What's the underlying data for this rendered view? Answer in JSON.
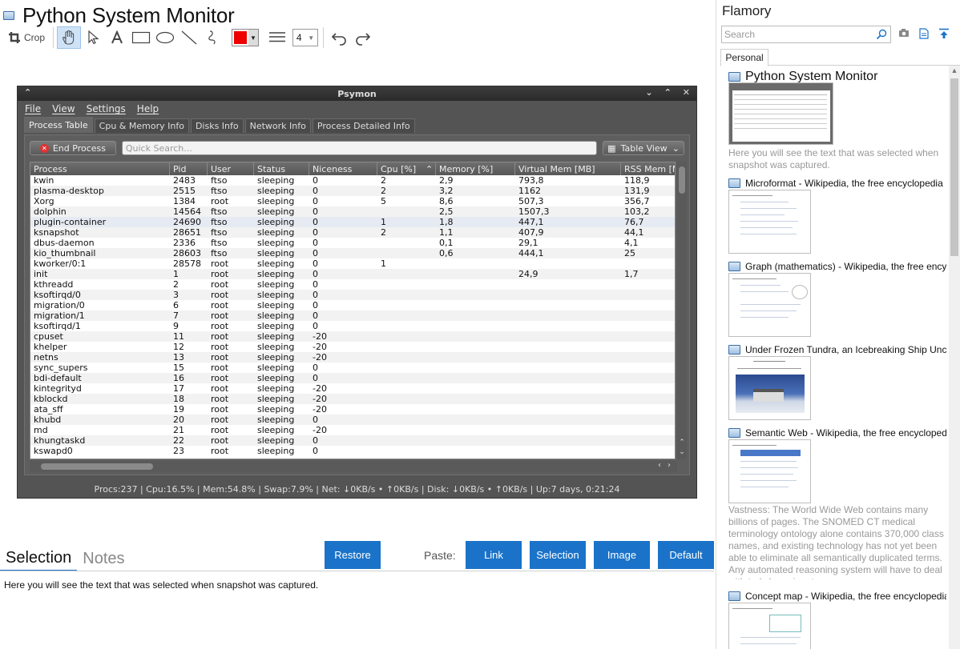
{
  "app": {
    "title": "Python System Monitor",
    "toolbar": {
      "crop_label": "Crop",
      "line_width": "4"
    }
  },
  "psymon": {
    "title": "Psymon",
    "menu": [
      "File",
      "View",
      "Settings",
      "Help"
    ],
    "tabs": [
      "Process Table",
      "Cpu & Memory Info",
      "Disks Info",
      "Network Info",
      "Process Detailed Info"
    ],
    "end_process_label": "End Process",
    "search_placeholder": "Quick Search...",
    "view_label": "Table View",
    "columns": [
      "Process",
      "Pid",
      "User",
      "Status",
      "Niceness",
      "Cpu [%]",
      "Memory [%]",
      "Virtual Mem [MB]",
      "RSS Mem [M"
    ],
    "rows": [
      [
        "kwin",
        "2483",
        "ftso",
        "sleeping",
        "0",
        "2",
        "2,9",
        "793,8",
        "118,9"
      ],
      [
        "plasma-desktop",
        "2515",
        "ftso",
        "sleeping",
        "0",
        "2",
        "3,2",
        "1162",
        "131,9"
      ],
      [
        "Xorg",
        "1384",
        "root",
        "sleeping",
        "0",
        "5",
        "8,6",
        "507,3",
        "356,7"
      ],
      [
        "dolphin",
        "14564",
        "ftso",
        "sleeping",
        "0",
        "",
        "2,5",
        "1507,3",
        "103,2"
      ],
      [
        "plugin-container",
        "24690",
        "ftso",
        "sleeping",
        "0",
        "1",
        "1,8",
        "447,1",
        "76,7"
      ],
      [
        "ksnapshot",
        "28651",
        "ftso",
        "sleeping",
        "0",
        "2",
        "1,1",
        "407,9",
        "44,1"
      ],
      [
        "dbus-daemon",
        "2336",
        "ftso",
        "sleeping",
        "0",
        "",
        "0,1",
        "29,1",
        "4,1"
      ],
      [
        "kio_thumbnail",
        "28603",
        "ftso",
        "sleeping",
        "0",
        "",
        "0,6",
        "444,1",
        "25"
      ],
      [
        "kworker/0:1",
        "28578",
        "root",
        "sleeping",
        "0",
        "1",
        "",
        "",
        ""
      ],
      [
        "init",
        "1",
        "root",
        "sleeping",
        "0",
        "",
        "",
        "24,9",
        "1,7"
      ],
      [
        "kthreadd",
        "2",
        "root",
        "sleeping",
        "0",
        "",
        "",
        "",
        ""
      ],
      [
        "ksoftirqd/0",
        "3",
        "root",
        "sleeping",
        "0",
        "",
        "",
        "",
        ""
      ],
      [
        "migration/0",
        "6",
        "root",
        "sleeping",
        "0",
        "",
        "",
        "",
        ""
      ],
      [
        "migration/1",
        "7",
        "root",
        "sleeping",
        "0",
        "",
        "",
        "",
        ""
      ],
      [
        "ksoftirqd/1",
        "9",
        "root",
        "sleeping",
        "0",
        "",
        "",
        "",
        ""
      ],
      [
        "cpuset",
        "11",
        "root",
        "sleeping",
        "-20",
        "",
        "",
        "",
        ""
      ],
      [
        "khelper",
        "12",
        "root",
        "sleeping",
        "-20",
        "",
        "",
        "",
        ""
      ],
      [
        "netns",
        "13",
        "root",
        "sleeping",
        "-20",
        "",
        "",
        "",
        ""
      ],
      [
        "sync_supers",
        "15",
        "root",
        "sleeping",
        "0",
        "",
        "",
        "",
        ""
      ],
      [
        "bdi-default",
        "16",
        "root",
        "sleeping",
        "0",
        "",
        "",
        "",
        ""
      ],
      [
        "kintegrityd",
        "17",
        "root",
        "sleeping",
        "-20",
        "",
        "",
        "",
        ""
      ],
      [
        "kblockd",
        "18",
        "root",
        "sleeping",
        "-20",
        "",
        "",
        "",
        ""
      ],
      [
        "ata_sff",
        "19",
        "root",
        "sleeping",
        "-20",
        "",
        "",
        "",
        ""
      ],
      [
        "khubd",
        "20",
        "root",
        "sleeping",
        "0",
        "",
        "",
        "",
        ""
      ],
      [
        "md",
        "21",
        "root",
        "sleeping",
        "-20",
        "",
        "",
        "",
        ""
      ],
      [
        "khungtaskd",
        "22",
        "root",
        "sleeping",
        "0",
        "",
        "",
        "",
        ""
      ],
      [
        "kswapd0",
        "23",
        "root",
        "sleeping",
        "0",
        "",
        "",
        "",
        ""
      ]
    ],
    "status": "Procs:237 | Cpu:16.5% | Mem:54.8% | Swap:7.9% | Net: ↓0KB/s • ↑0KB/s | Disk: ↓0KB/s • ↑0KB/s | Up:7 days, 0:21:24"
  },
  "bottom": {
    "tabs": [
      "Selection",
      "Notes"
    ],
    "restore_label": "Restore",
    "paste_label": "Paste:",
    "paste_buttons": [
      "Link",
      "Selection",
      "Image",
      "Default"
    ],
    "selection_text": "Here you will see the text that was selected when snapshot was captured."
  },
  "sidebar": {
    "brand": "Flamory",
    "search_placeholder": "Search",
    "tab": "Personal",
    "entries": [
      {
        "title": "Python System Monitor",
        "desc": "Here you will see the text that was selected when snapshot was captured."
      },
      {
        "title": "Microformat - Wikipedia, the free encyclopedia",
        "desc": ""
      },
      {
        "title": "Graph (mathematics) - Wikipedia, the free encyclopedia",
        "desc": ""
      },
      {
        "title": "Under Frozen Tundra, an Icebreaking Ship Uncovers",
        "desc": ""
      },
      {
        "title": "Semantic Web - Wikipedia, the free encyclopedia",
        "desc": "Vastness: The World Wide Web contains many billions of pages. The SNOMED CT medical terminology ontology alone contains 370,000 class names, and existing technology has not yet been able to eliminate all semantically duplicated terms. Any automated reasoning system will have to deal with truly huge inputs."
      },
      {
        "title": "Concept map - Wikipedia, the free encyclopedia",
        "desc": ""
      }
    ]
  },
  "colors": {
    "accent": "#1a73c9",
    "pen_color": "#e00000"
  }
}
